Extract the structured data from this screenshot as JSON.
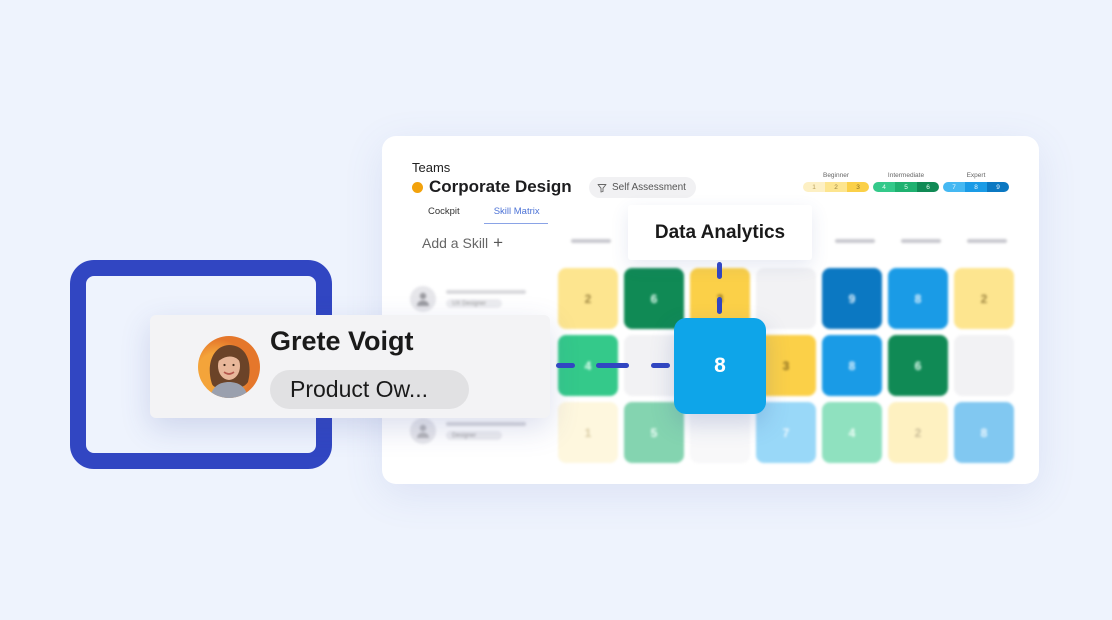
{
  "app": {
    "breadcrumb": "Teams",
    "team_name": "Corporate Design",
    "team_color": "#f2a20c",
    "filter_label": "Self Assessment",
    "tabs": [
      {
        "label": "Cockpit",
        "active": false
      },
      {
        "label": "Skill Matrix",
        "active": true
      }
    ],
    "add_skill_label": "Add a Skill",
    "add_skill_icon": "plus-icon"
  },
  "legend": [
    {
      "label": "Beginner",
      "levels": [
        {
          "value": "1",
          "color": "#fdf0c4",
          "text": "#b9a05a"
        },
        {
          "value": "2",
          "color": "#fde58f",
          "text": "#9c8440"
        },
        {
          "value": "3",
          "color": "#fbd048",
          "text": "#8a6d20"
        }
      ]
    },
    {
      "label": "Intermediate",
      "levels": [
        {
          "value": "4",
          "color": "#34c98a",
          "text": "#e6fff4"
        },
        {
          "value": "5",
          "color": "#1fb170",
          "text": "#e6fff4"
        },
        {
          "value": "6",
          "color": "#108a55",
          "text": "#e6fff4"
        }
      ]
    },
    {
      "label": "Expert",
      "levels": [
        {
          "value": "7",
          "color": "#45b8f2",
          "text": "#e7f6ff"
        },
        {
          "value": "8",
          "color": "#1a9be6",
          "text": "#e7f6ff"
        },
        {
          "value": "9",
          "color": "#0b78c2",
          "text": "#e7f6ff"
        }
      ]
    }
  ],
  "people_rows": [
    {
      "role": "UX Designer"
    },
    {
      "role": "Product Owner"
    },
    {
      "role": "Designer"
    }
  ],
  "matrix": [
    [
      "2",
      "6",
      "3",
      "",
      "9",
      "8",
      "2"
    ],
    [
      "4",
      "",
      "8",
      "3",
      "8",
      "6",
      ""
    ],
    [
      "1",
      "5",
      "",
      "7",
      "4",
      "2",
      "8"
    ]
  ],
  "highlight": {
    "person_name": "Grete Voigt",
    "person_role": "Product Ow...",
    "skill": "Data Analytics",
    "value": "8",
    "accent": "#3146c2",
    "value_color": "#0ea5e9"
  }
}
